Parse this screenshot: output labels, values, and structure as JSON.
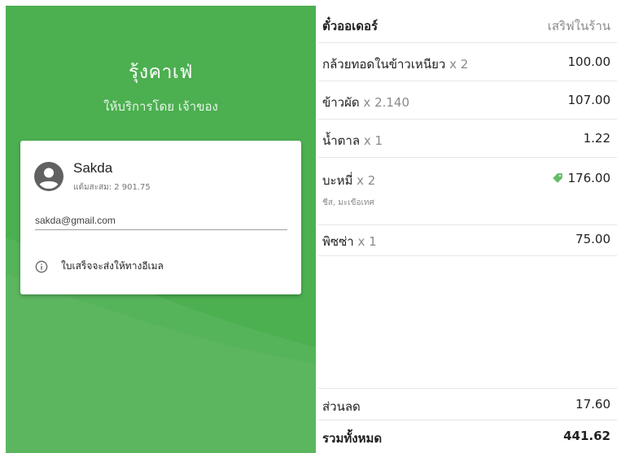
{
  "shop": {
    "name": "รุ้งคาเฟ่",
    "served_by": "ให้บริการโดย เจ้าของ"
  },
  "customer": {
    "name": "Sakda",
    "points_label": "แต้มสะสม: 2 901.75",
    "email": "sakda@gmail.com",
    "receipt_note": "ใบเสร็จจะส่งให้ทางอีเมล"
  },
  "order": {
    "table_label": "ตั๋วออเดอร์",
    "dine_type": "เสริฟในร้าน",
    "items": [
      {
        "name": "กล้วยทอดในข้าวเหนียว",
        "qty": "x 2",
        "price": "100.00",
        "note": "",
        "has_discount_tag": false
      },
      {
        "name": "ข้าวผัด",
        "qty": "x 2.140",
        "price": "107.00",
        "note": "",
        "has_discount_tag": false
      },
      {
        "name": "น้ำตาล",
        "qty": "x 1",
        "price": "1.22",
        "note": "",
        "has_discount_tag": false
      },
      {
        "name": "บะหมี่",
        "qty": "x 2",
        "price": "176.00",
        "note": "ชีส, มะเขือเทศ",
        "has_discount_tag": true
      },
      {
        "name": "พิซซ่า",
        "qty": "x 1",
        "price": "75.00",
        "note": "",
        "has_discount_tag": false
      }
    ],
    "discount_label": "ส่วนลด",
    "discount_value": "17.60",
    "total_label": "รวมทั้งหมด",
    "total_value": "441.62"
  },
  "colors": {
    "panel_green": "#4caf50",
    "tag_green": "#66bb6a"
  },
  "icons": [
    "account-circle-icon",
    "info-icon",
    "discount-tag-icon"
  ]
}
